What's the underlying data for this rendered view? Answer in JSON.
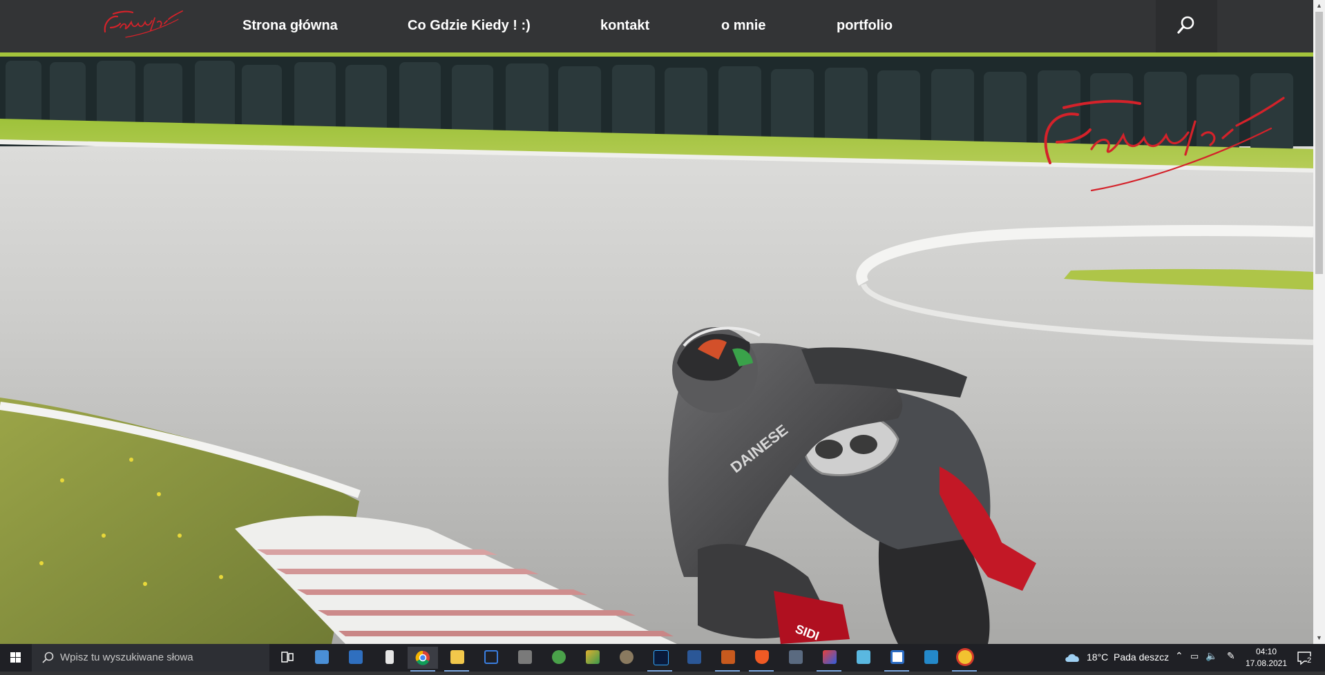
{
  "site": {
    "logo_text": "Fotonotek.pl",
    "watermark_text": "Fotonotek.pl"
  },
  "nav": {
    "items": [
      {
        "label": "Strona główna"
      },
      {
        "label": "Co Gdzie Kiedy ! :)"
      },
      {
        "label": "kontakt"
      },
      {
        "label": "o mnie"
      },
      {
        "label": "portfolio"
      }
    ],
    "search_icon": "search-icon"
  },
  "hero": {
    "image": "motorcycle-racer-cornering-on-track",
    "rider_suit_brand": "DAINESE",
    "boot_brand": "SIDI"
  },
  "taskbar": {
    "search_placeholder": "Wpisz tu wyszukiwane słowa",
    "apps": [
      "task-view-icon",
      "explorer-app-icon",
      "media-app-icon",
      "phone-app-icon",
      "chrome-icon",
      "file-explorer-icon",
      "text-app-icon",
      "video-app-icon",
      "torrent-icon",
      "paint-icon",
      "gimp-icon",
      "photoshop-icon",
      "word-icon",
      "slides-app-icon",
      "brave-icon",
      "calculator-icon",
      "ide-icon",
      "notes-app-icon",
      "capture-app-icon",
      "vscode-icon",
      "game-app-icon"
    ],
    "weather": {
      "temperature": "18°C",
      "condition": "Pada deszcz"
    },
    "time": "04:10",
    "date": "17.08.2021",
    "notification_count": "2"
  },
  "colors": {
    "nav_bg": "#333436",
    "logo_red": "#d4222a",
    "taskbar_bg": "#1f2025"
  }
}
